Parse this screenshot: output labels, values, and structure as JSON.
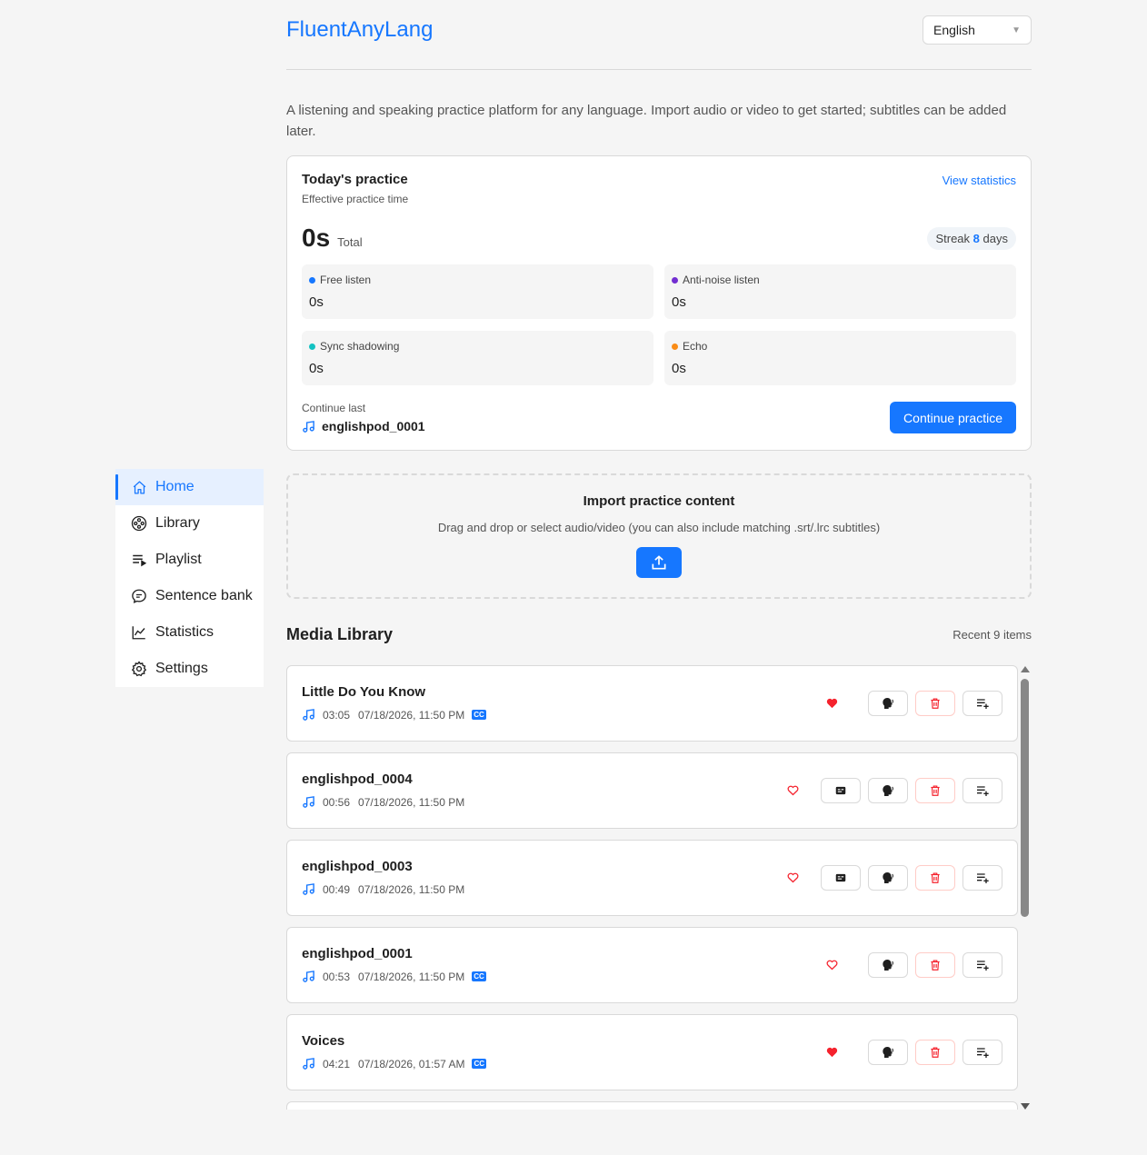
{
  "app": {
    "title": "FluentAnyLang",
    "language": "English"
  },
  "intro": "A listening and speaking practice platform for any language. Import audio or video to get started; subtitles can be added later.",
  "nav": [
    {
      "label": "Home",
      "icon": "home-icon",
      "active": true
    },
    {
      "label": "Library",
      "icon": "film-reel-icon"
    },
    {
      "label": "Playlist",
      "icon": "playlist-icon"
    },
    {
      "label": "Sentence bank",
      "icon": "chat-bubble-icon"
    },
    {
      "label": "Statistics",
      "icon": "line-chart-icon"
    },
    {
      "label": "Settings",
      "icon": "gear-icon"
    }
  ],
  "practice": {
    "title": "Today's practice",
    "subtitle": "Effective practice time",
    "view_stats": "View statistics",
    "total_value": "0s",
    "total_label": "Total",
    "streak_prefix": "Streak",
    "streak_days": "8",
    "streak_suffix": "days",
    "modes": [
      {
        "label": "Free listen",
        "value": "0s",
        "color": "#1677ff"
      },
      {
        "label": "Anti-noise listen",
        "value": "0s",
        "color": "#722ed1"
      },
      {
        "label": "Sync shadowing",
        "value": "0s",
        "color": "#13c2c2"
      },
      {
        "label": "Echo",
        "value": "0s",
        "color": "#fa8c16"
      }
    ],
    "continue_label": "Continue last",
    "continue_file": "englishpod_0001",
    "continue_button": "Continue practice"
  },
  "import": {
    "title": "Import practice content",
    "description": "Drag and drop or select audio/video (you can also include matching .srt/.lrc subtitles)"
  },
  "library": {
    "title": "Media Library",
    "count_label": "Recent 9 items",
    "items": [
      {
        "title": "Little Do You Know",
        "duration": "03:05",
        "date": "07/18/2026, 11:50 PM",
        "cc": true,
        "favorite": true,
        "has_subtitle_btn": false
      },
      {
        "title": "englishpod_0004",
        "duration": "00:56",
        "date": "07/18/2026, 11:50 PM",
        "cc": false,
        "favorite": false,
        "has_subtitle_btn": true
      },
      {
        "title": "englishpod_0003",
        "duration": "00:49",
        "date": "07/18/2026, 11:50 PM",
        "cc": false,
        "favorite": false,
        "has_subtitle_btn": true
      },
      {
        "title": "englishpod_0001",
        "duration": "00:53",
        "date": "07/18/2026, 11:50 PM",
        "cc": true,
        "favorite": false,
        "has_subtitle_btn": false
      },
      {
        "title": "Voices",
        "duration": "04:21",
        "date": "07/18/2026, 01:57 AM",
        "cc": true,
        "favorite": true,
        "has_subtitle_btn": false
      }
    ],
    "cc_badge": "CC"
  }
}
